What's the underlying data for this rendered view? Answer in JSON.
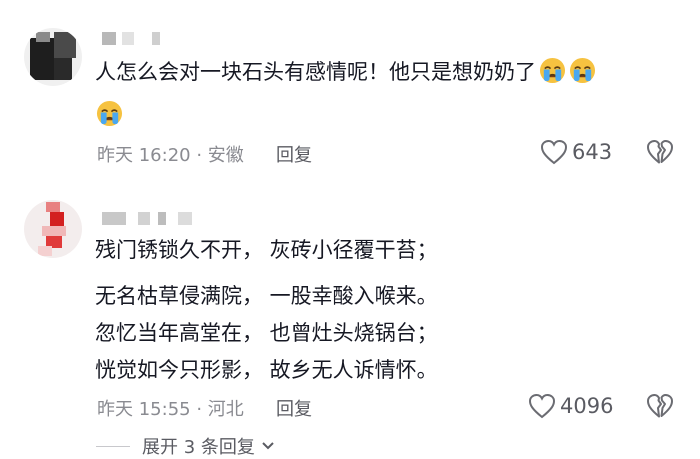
{
  "comments": [
    {
      "text": "人怎么会对一块石头有感情呢！他只是想奶奶了",
      "emojis": [
        "crying-face",
        "crying-face",
        "crying-face"
      ],
      "time": "昨天 16:20 · 安徽",
      "reply_label": "回复",
      "likes": "643"
    },
    {
      "poem": [
        "残门锈锁久不开，  灰砖小径覆干苔；",
        "无名枯草侵满院，  一股幸酸入喉来。",
        "忽忆当年高堂在，  也曾灶头烧锅台；",
        "恍觉如今只形影，  故乡无人诉情怀。"
      ],
      "time": "昨天 15:55 · 河北",
      "reply_label": "回复",
      "likes": "4096"
    }
  ],
  "expand_replies_label": "展开 3 条回复",
  "colors": {
    "text": "#161823",
    "meta": "#8a8b91",
    "emoji": "#f6c240",
    "tears": "#4aa8f0"
  }
}
